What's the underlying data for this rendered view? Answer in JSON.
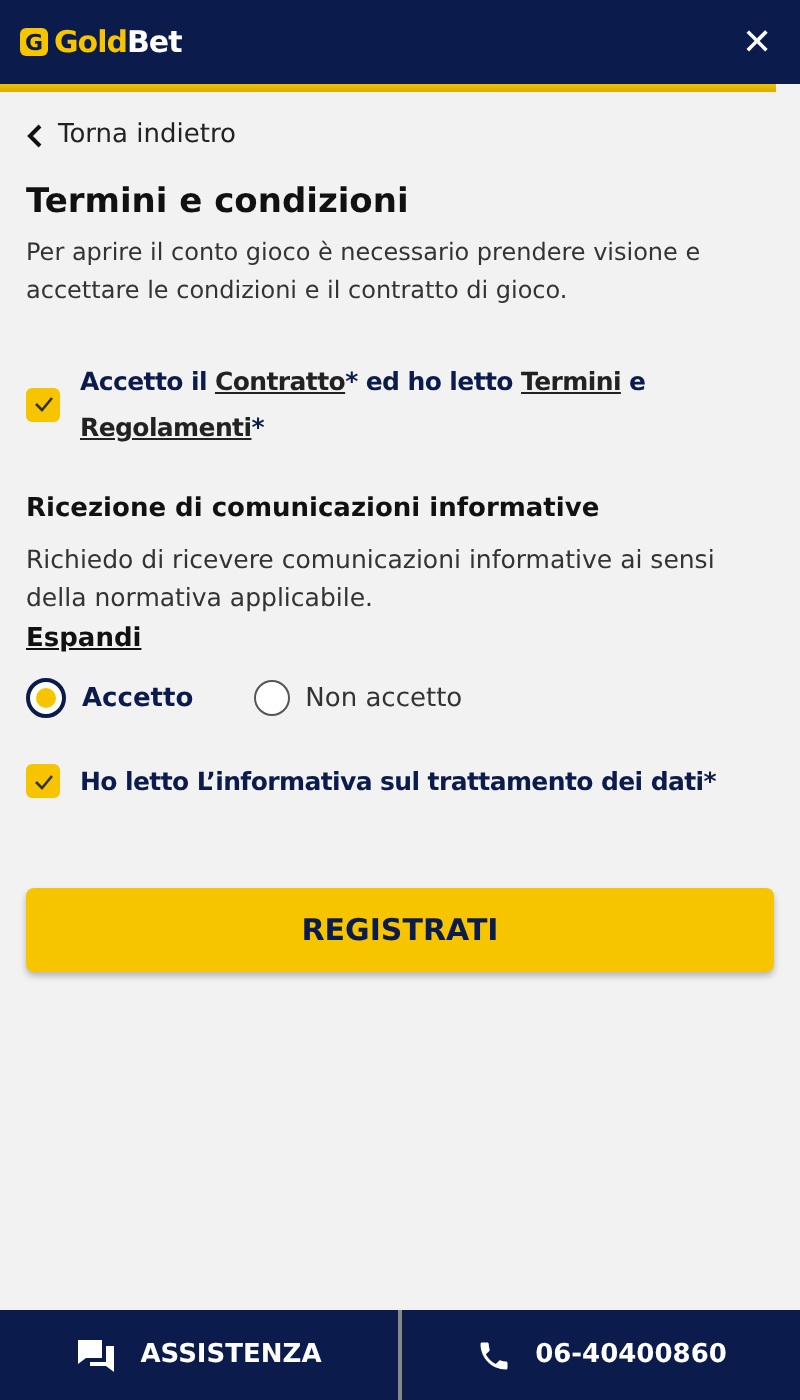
{
  "header": {
    "logo_mark": "G",
    "logo_gold": "Gold",
    "logo_white": "Bet",
    "close": "✕"
  },
  "back": {
    "label": "Torna indietro"
  },
  "title": "Termini e condizioni",
  "intro": "Per aprire il conto gioco è necessario prendere visione e accettare le condizioni e il contratto di gioco.",
  "contract_check": {
    "checked": true,
    "segments": [
      {
        "text": "Accetto il ",
        "link": false
      },
      {
        "text": "Contratto",
        "link": true
      },
      {
        "text": "* ed ho letto ",
        "link": false
      },
      {
        "text": "Termini",
        "link": true
      },
      {
        "text": " e ",
        "link": false
      },
      {
        "text": "Regolamenti",
        "link": true
      },
      {
        "text": "*",
        "link": false
      }
    ]
  },
  "communications": {
    "heading": "Ricezione di comunicazioni informative",
    "text": "Richiedo di ricevere comunicazioni informative ai sensi della normativa applicabile.",
    "expand": "Espandi",
    "options": [
      {
        "label": "Accetto",
        "selected": true
      },
      {
        "label": "Non accetto",
        "selected": false
      }
    ]
  },
  "privacy_check": {
    "checked": true,
    "label": "Ho letto L’informativa sul trattamento dei dati*"
  },
  "submit": "REGISTRATI",
  "footer": [
    {
      "kind": "chat",
      "label": "ASSISTENZA"
    },
    {
      "kind": "phone",
      "label": "06-40400860"
    }
  ]
}
